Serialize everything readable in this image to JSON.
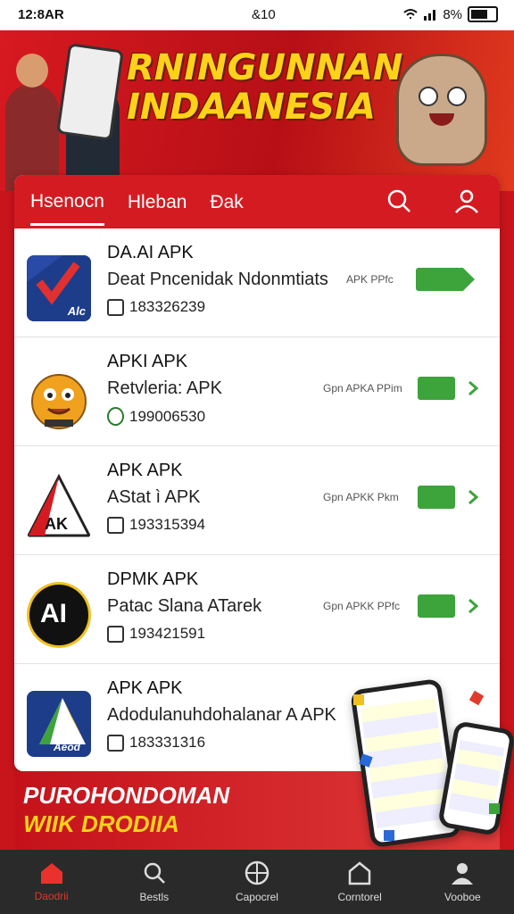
{
  "status_bar": {
    "time": "12:8AR",
    "center": "&10",
    "battery": "8%"
  },
  "banner": {
    "title_line1": "RNINGUNNAN",
    "title_line2": "INDAANESIA"
  },
  "tabs": [
    {
      "label": "Hsenocn",
      "active": true
    },
    {
      "label": "Hleban",
      "active": false
    },
    {
      "label": "Ðak",
      "active": false
    }
  ],
  "apps": [
    {
      "name": "DA.AI APK",
      "desc": "Deat Pncenidak Ndonmtiats",
      "id": "183326239",
      "button_label": "APK PPfc",
      "logo_text": "Alc",
      "logo_color": "#2a4aa8"
    },
    {
      "name": "APKI APK",
      "desc": "Retvleria: APK",
      "id": "199006530",
      "button_label": "Gpn APKA PPim",
      "logo_text": "",
      "logo_color": "#f0a21e"
    },
    {
      "name": "APK APK",
      "desc": "AStat ì APK",
      "id": "193315394",
      "button_label": "Gpn APKK Pkm",
      "logo_text": "AK",
      "logo_color": "#ffffff"
    },
    {
      "name": "DPMK APK",
      "desc": "Patac Slana ATarek",
      "id": "193421591",
      "button_label": "Gpn APKK PPfc",
      "logo_text": "AI",
      "logo_color": "#111111"
    },
    {
      "name": "APK APK",
      "desc": "Adodulanuhdohalanar A APK",
      "id": "183331316",
      "button_label": "",
      "logo_text": "Aeod",
      "logo_color": "#1d3d8a"
    }
  ],
  "promo": {
    "line1": "PUROHONDOMAN",
    "line2": "WIIK DRODIIA"
  },
  "bottom_nav": [
    {
      "label": "Daodrii",
      "icon": "home-icon",
      "active": true
    },
    {
      "label": "Bestls",
      "icon": "search-icon",
      "active": false
    },
    {
      "label": "Capocrel",
      "icon": "grid-icon",
      "active": false
    },
    {
      "label": "Corntorel",
      "icon": "box-icon",
      "active": false
    },
    {
      "label": "Vooboe",
      "icon": "profile-icon",
      "active": false
    }
  ],
  "colors": {
    "brand_red": "#d51b22",
    "download_green": "#3da33b",
    "nav_dark": "#2a2a2a"
  }
}
